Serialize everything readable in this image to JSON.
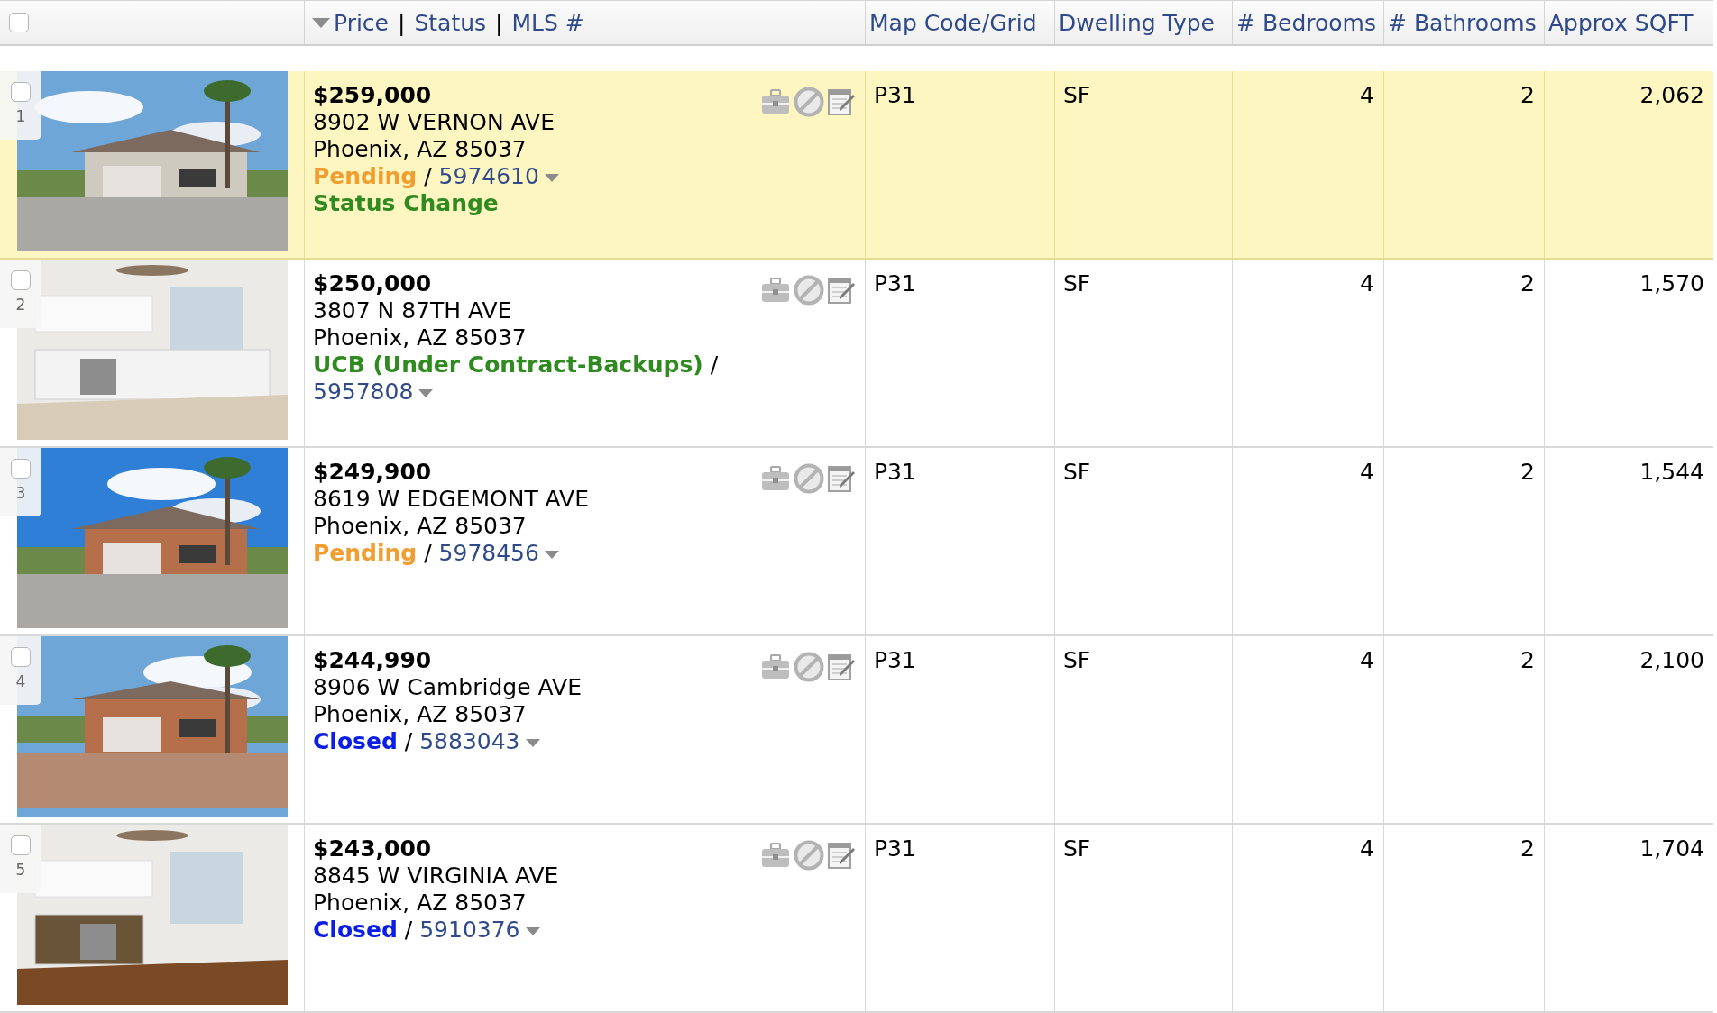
{
  "header": {
    "select_all": {
      "checked": false
    },
    "price_status_mls": {
      "sorted_descending": true,
      "parts": [
        "Price",
        "|",
        "Status",
        "|",
        "MLS #"
      ]
    },
    "columns": [
      "Map Code/Grid",
      "Dwelling Type",
      "# Bedrooms",
      "# Bathrooms",
      "Approx SQFT"
    ]
  },
  "rows": [
    {
      "number": "1",
      "checked": false,
      "highlighted": true,
      "price": "$259,000",
      "address": "8902 W VERNON AVE",
      "city": "Phoenix, AZ 85037",
      "status": {
        "text": "Pending",
        "color": "#f29d2f"
      },
      "separator": "/",
      "mls": "5974610",
      "note": "Status Change",
      "map_code": "P31",
      "dwelling_type": "SF",
      "bedrooms": "4",
      "bathrooms": "2",
      "sqft": "2,062"
    },
    {
      "number": "2",
      "checked": false,
      "highlighted": false,
      "price": "$250,000",
      "address": "3807 N 87TH AVE",
      "city": "Phoenix, AZ 85037",
      "status": {
        "text": "UCB (Under Contract-Backups)",
        "color": "#2f8a1f"
      },
      "separator": "/",
      "mls": "5957808",
      "map_code": "P31",
      "dwelling_type": "SF",
      "bedrooms": "4",
      "bathrooms": "2",
      "sqft": "1,570"
    },
    {
      "number": "3",
      "checked": false,
      "highlighted": false,
      "price": "$249,900",
      "address": "8619 W EDGEMONT AVE",
      "city": "Phoenix, AZ 85037",
      "status": {
        "text": "Pending",
        "color": "#f29d2f"
      },
      "separator": "/",
      "mls": "5978456",
      "map_code": "P31",
      "dwelling_type": "SF",
      "bedrooms": "4",
      "bathrooms": "2",
      "sqft": "1,544"
    },
    {
      "number": "4",
      "checked": false,
      "highlighted": false,
      "price": "$244,990",
      "address": "8906 W Cambridge AVE",
      "city": "Phoenix, AZ 85037",
      "status": {
        "text": "Closed",
        "color": "#0b1ee6"
      },
      "separator": "/",
      "mls": "5883043",
      "map_code": "P31",
      "dwelling_type": "SF",
      "bedrooms": "4",
      "bathrooms": "2",
      "sqft": "2,100"
    },
    {
      "number": "5",
      "checked": false,
      "highlighted": false,
      "price": "$243,000",
      "address": "8845 W VIRGINIA AVE",
      "city": "Phoenix, AZ 85037",
      "status": {
        "text": "Closed",
        "color": "#0b1ee6"
      },
      "separator": "/",
      "mls": "5910376",
      "map_code": "P31",
      "dwelling_type": "SF",
      "bedrooms": "4",
      "bathrooms": "2",
      "sqft": "1,704"
    }
  ]
}
